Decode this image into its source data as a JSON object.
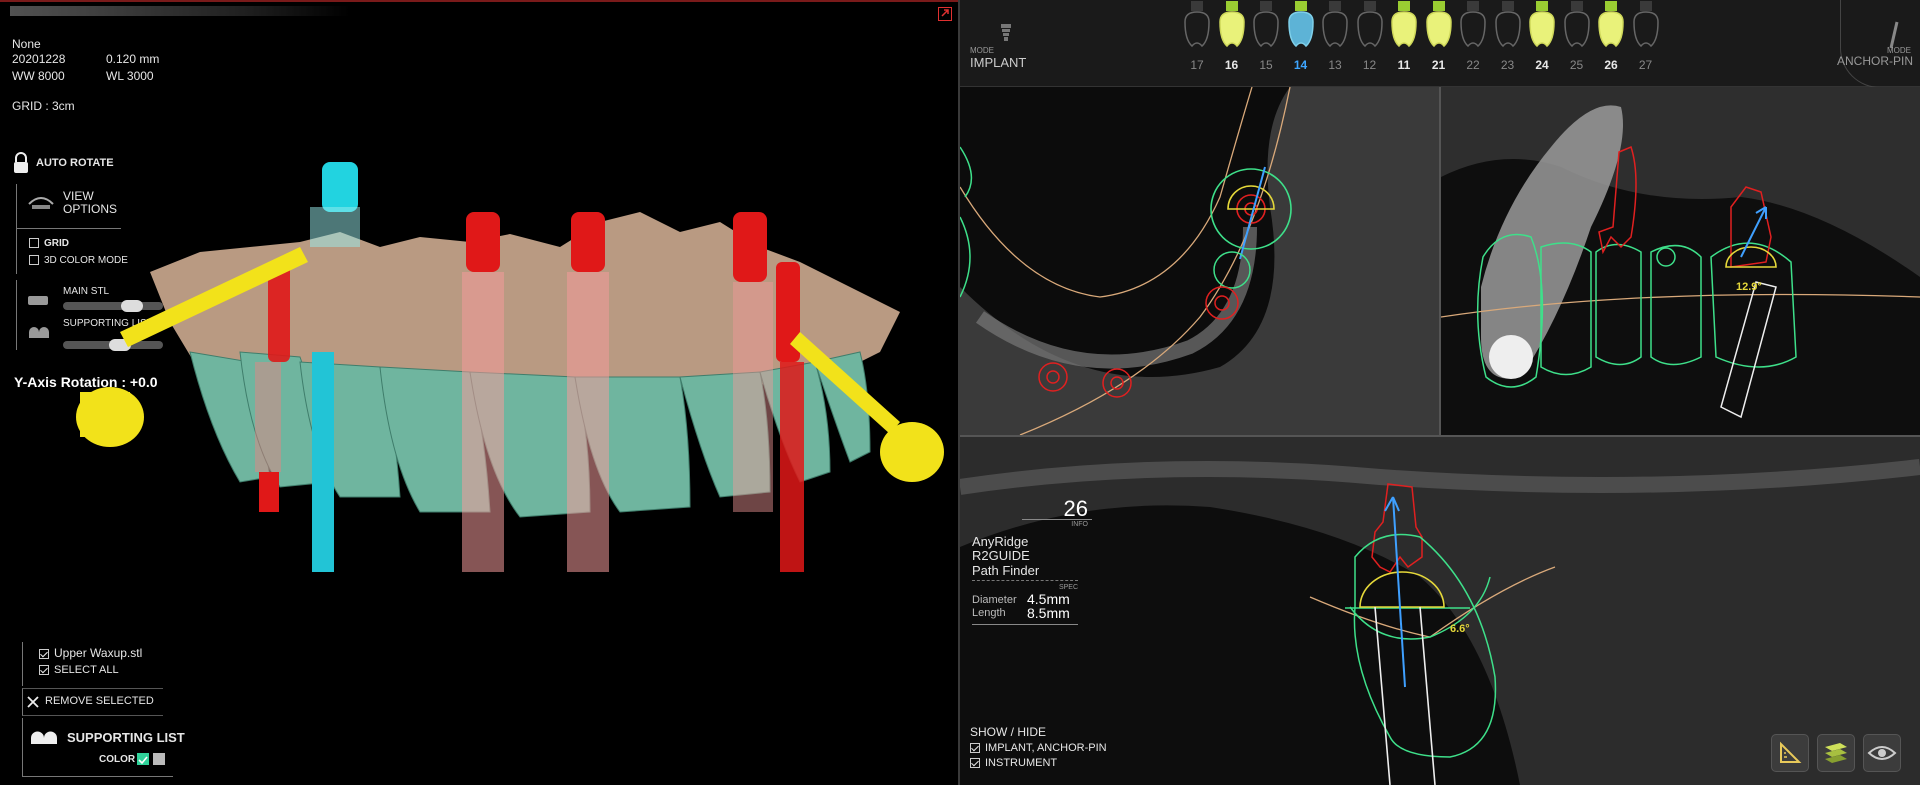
{
  "left": {
    "info": {
      "name": "None",
      "date": "20201228",
      "spacing": "0.120 mm",
      "ww": "WW 8000",
      "wl": "WL 3000",
      "grid": "GRID : 3cm"
    },
    "auto_rotate": "AUTO ROTATE",
    "view_options": "VIEW\nOPTIONS",
    "view_options_line1": "VIEW",
    "view_options_line2": "OPTIONS",
    "grid_label": "GRID",
    "color_mode_label": "3D COLOR MODE",
    "main_stl_label": "MAIN STL",
    "supporting_list_label": "SUPPORTING LIST",
    "rotation_label": "Y-Axis Rotation : +0.0",
    "files": [
      {
        "label": "Upper Waxup.stl",
        "checked": true
      }
    ],
    "select_all": "SELECT ALL",
    "remove_selected": "REMOVE SELECTED",
    "supporting_list_title": "SUPPORTING LIST",
    "color_label": "COLOR",
    "colors": {
      "accent_green": "#2fd39a",
      "implant_red": "#e01818",
      "implant_cyan": "#22d3e0",
      "pin_yellow": "#f2e21a"
    }
  },
  "toolbar": {
    "mode_small": "MODE",
    "mode_left": "IMPLANT",
    "mode_right": "ANCHOR-PIN",
    "teeth": [
      {
        "num": "17",
        "state": "empty"
      },
      {
        "num": "16",
        "state": "planned"
      },
      {
        "num": "15",
        "state": "empty"
      },
      {
        "num": "14",
        "state": "selected"
      },
      {
        "num": "13",
        "state": "empty"
      },
      {
        "num": "12",
        "state": "empty"
      },
      {
        "num": "11",
        "state": "planned"
      },
      {
        "num": "21",
        "state": "planned"
      },
      {
        "num": "22",
        "state": "empty"
      },
      {
        "num": "23",
        "state": "empty"
      },
      {
        "num": "24",
        "state": "planned"
      },
      {
        "num": "25",
        "state": "empty"
      },
      {
        "num": "26",
        "state": "planned"
      },
      {
        "num": "27",
        "state": "empty"
      }
    ]
  },
  "views": {
    "angle_sagittal": "12.9°",
    "angle_cross": "6.6°"
  },
  "info_panel": {
    "tooth": "26",
    "info_label": "INFO",
    "lines": [
      "AnyRidge",
      "R2GUIDE",
      "Path Finder"
    ],
    "spec_label": "SPEC",
    "diameter_label": "Diameter",
    "diameter": "4.5mm",
    "length_label": "Length",
    "length": "8.5mm"
  },
  "show_hide": {
    "title": "SHOW / HIDE",
    "items": [
      "IMPLANT, ANCHOR-PIN",
      "INSTRUMENT"
    ]
  }
}
